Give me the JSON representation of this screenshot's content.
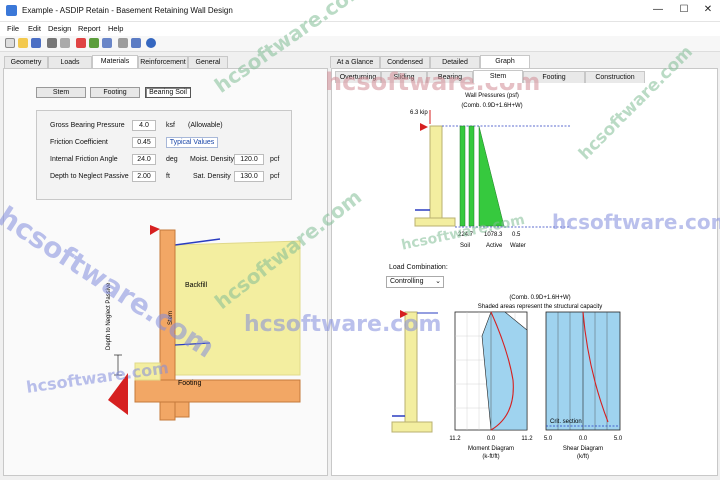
{
  "window": {
    "title": "Example - ASDIP Retain - Basement Retaining Wall Design",
    "minimize": "—",
    "maximize": "☐",
    "close": "✕"
  },
  "menu": [
    "File",
    "Edit",
    "Design",
    "Report",
    "Help"
  ],
  "toolbar": {
    "icons": [
      "new-icon",
      "open-icon",
      "save-icon",
      "print-icon",
      "print-preview-icon",
      "design-icon",
      "refresh-icon",
      "settings-icon",
      "copy-icon",
      "find-icon",
      "units-icon",
      "help-icon"
    ]
  },
  "left_tabs": [
    "Geometry",
    "Loads",
    "Materials",
    "Reinforcement",
    "General"
  ],
  "left_active_tab": "Materials",
  "sub_buttons": [
    "Stem",
    "Footing",
    "Bearing Soil"
  ],
  "sub_active": "Bearing Soil",
  "soil": {
    "gross_bearing_label": "Gross Bearing Pressure",
    "gross_bearing_value": "4.0",
    "gross_bearing_unit": "ksf",
    "gross_bearing_note": "(Allowable)",
    "friction_label": "Friction Coefficient",
    "friction_value": "0.45",
    "typical_values": "Typical Values",
    "angle_label": "Internal Friction Angle",
    "angle_value": "24.0",
    "angle_unit": "deg",
    "moist_label": "Moist. Density",
    "moist_value": "120.0",
    "moist_unit": "pcf",
    "depth_label": "Depth to Neglect Passive",
    "depth_value": "2.00",
    "depth_unit": "ft",
    "sat_label": "Sat. Density",
    "sat_value": "130.0",
    "sat_unit": "pcf"
  },
  "left_drawing": {
    "backfill": "Backfill",
    "stem": "Stem",
    "footing": "Footing",
    "depth_note": "Depth to Neglect Passive"
  },
  "right_tabs": [
    "At a Glance",
    "Condensed",
    "Detailed",
    "Graph"
  ],
  "right_active_tab": "Graph",
  "graph_tabs": [
    "Overturning",
    "Sliding",
    "Bearing",
    "Stem",
    "Footing",
    "Construction"
  ],
  "graph_active_tab": "Stem",
  "pressures": {
    "title": "Wall Pressures (psf)",
    "combo": "(Comb. 0.9D+1.6H+W)",
    "load": "6.3 kip",
    "values": [
      "224.7",
      "1078.3",
      "0.5"
    ],
    "labels": [
      "Soil",
      "Active",
      "Water"
    ]
  },
  "load_combination": {
    "label": "Load Combination:",
    "value": "Controlling"
  },
  "diagrams": {
    "combo": "(Comb. 0.9D+1.6H+W)",
    "note": "Shaded areas represent the structural capacity",
    "moment_ticks": [
      "11.2",
      "0.0",
      "11.2"
    ],
    "moment_title": "Moment Diagram",
    "moment_unit": "(k-ft/ft)",
    "shear_ticks": [
      "5.0",
      "0.0",
      "5.0"
    ],
    "shear_title": "Shear Diagram",
    "shear_unit": "(k/ft)",
    "crit": "Crit. section"
  },
  "watermark": "hcsoftware.com",
  "colors": {
    "concrete": "#f2a765",
    "backfill": "#f3eea0",
    "capacity": "#9fd3ef",
    "active": "#36c93e",
    "load_arrow": "#d62020"
  }
}
